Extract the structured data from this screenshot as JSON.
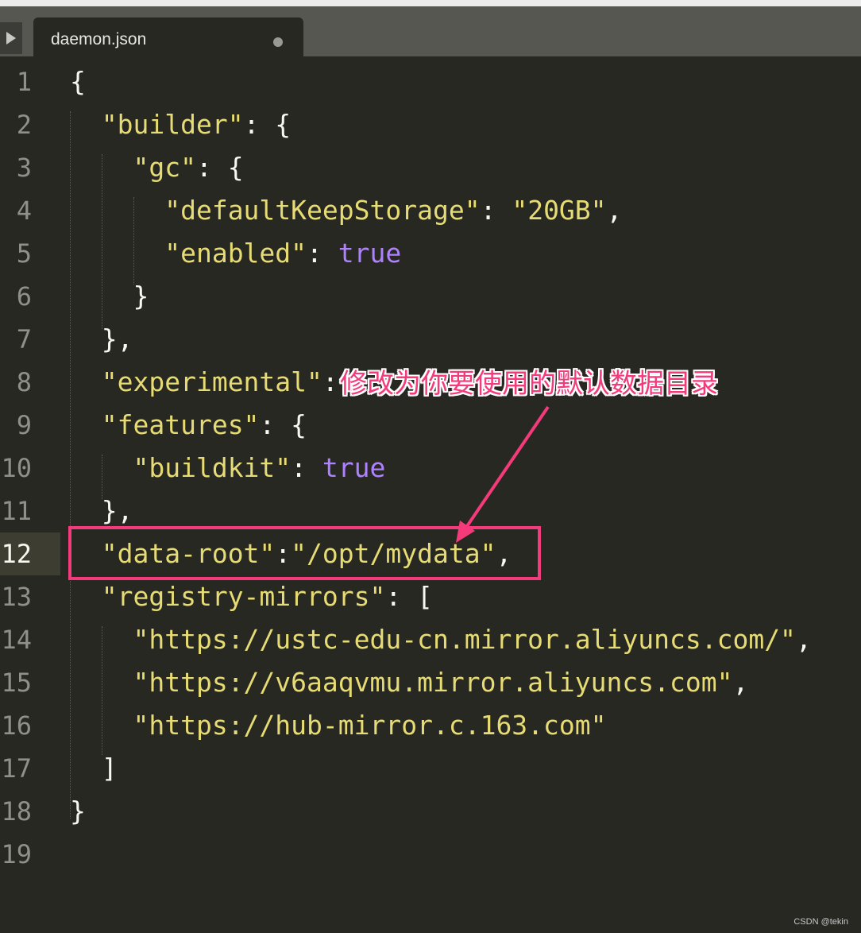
{
  "tab": {
    "title": "daemon.json",
    "modified": true
  },
  "editor": {
    "current_line": 12,
    "lines": [
      {
        "n": "1",
        "tokens": [
          {
            "t": "p",
            "v": "{"
          }
        ]
      },
      {
        "n": "2",
        "tokens": [
          {
            "t": "p",
            "v": "  "
          },
          {
            "t": "s",
            "v": "\"builder\""
          },
          {
            "t": "p",
            "v": ": {"
          }
        ]
      },
      {
        "n": "3",
        "tokens": [
          {
            "t": "p",
            "v": "    "
          },
          {
            "t": "s",
            "v": "\"gc\""
          },
          {
            "t": "p",
            "v": ": {"
          }
        ]
      },
      {
        "n": "4",
        "tokens": [
          {
            "t": "p",
            "v": "      "
          },
          {
            "t": "s",
            "v": "\"defaultKeepStorage\""
          },
          {
            "t": "p",
            "v": ": "
          },
          {
            "t": "s",
            "v": "\"20GB\""
          },
          {
            "t": "p",
            "v": ","
          }
        ]
      },
      {
        "n": "5",
        "tokens": [
          {
            "t": "p",
            "v": "      "
          },
          {
            "t": "s",
            "v": "\"enabled\""
          },
          {
            "t": "p",
            "v": ": "
          },
          {
            "t": "k",
            "v": "true"
          }
        ]
      },
      {
        "n": "6",
        "tokens": [
          {
            "t": "p",
            "v": "    }"
          }
        ]
      },
      {
        "n": "7",
        "tokens": [
          {
            "t": "p",
            "v": "  },"
          }
        ]
      },
      {
        "n": "8",
        "tokens": [
          {
            "t": "p",
            "v": "  "
          },
          {
            "t": "s",
            "v": "\"experimental\""
          },
          {
            "t": "p",
            "v": ":"
          }
        ]
      },
      {
        "n": "9",
        "tokens": [
          {
            "t": "p",
            "v": "  "
          },
          {
            "t": "s",
            "v": "\"features\""
          },
          {
            "t": "p",
            "v": ": {"
          }
        ]
      },
      {
        "n": "10",
        "tokens": [
          {
            "t": "p",
            "v": "    "
          },
          {
            "t": "s",
            "v": "\"buildkit\""
          },
          {
            "t": "p",
            "v": ": "
          },
          {
            "t": "k",
            "v": "true"
          }
        ]
      },
      {
        "n": "11",
        "tokens": [
          {
            "t": "p",
            "v": "  },"
          }
        ]
      },
      {
        "n": "12",
        "tokens": [
          {
            "t": "p",
            "v": "  "
          },
          {
            "t": "s",
            "v": "\"data-root\""
          },
          {
            "t": "p",
            "v": ":"
          },
          {
            "t": "s",
            "v": "\"/opt/mydata\""
          },
          {
            "t": "p",
            "v": ","
          }
        ]
      },
      {
        "n": "13",
        "tokens": [
          {
            "t": "p",
            "v": "  "
          },
          {
            "t": "s",
            "v": "\"registry-mirrors\""
          },
          {
            "t": "p",
            "v": ": ["
          }
        ]
      },
      {
        "n": "14",
        "tokens": [
          {
            "t": "p",
            "v": "    "
          },
          {
            "t": "s",
            "v": "\"https://ustc-edu-cn.mirror.aliyuncs.com/\""
          },
          {
            "t": "p",
            "v": ","
          }
        ]
      },
      {
        "n": "15",
        "tokens": [
          {
            "t": "p",
            "v": "    "
          },
          {
            "t": "s",
            "v": "\"https://v6aaqvmu.mirror.aliyuncs.com\""
          },
          {
            "t": "p",
            "v": ","
          }
        ]
      },
      {
        "n": "16",
        "tokens": [
          {
            "t": "p",
            "v": "    "
          },
          {
            "t": "s",
            "v": "\"https://hub-mirror.c.163.com\""
          }
        ]
      },
      {
        "n": "17",
        "tokens": [
          {
            "t": "p",
            "v": "  ]"
          }
        ]
      },
      {
        "n": "18",
        "tokens": [
          {
            "t": "p",
            "v": "}"
          }
        ]
      },
      {
        "n": "19",
        "tokens": []
      }
    ]
  },
  "annotation": {
    "text": "修改为你要使用的默认数据目录"
  },
  "watermark": "CSDN @tekin",
  "colors": {
    "background": "#272822",
    "string": "#e6db74",
    "keyword": "#ae81ff",
    "punctuation": "#f8f8f2",
    "annotation": "#f53a7b"
  }
}
